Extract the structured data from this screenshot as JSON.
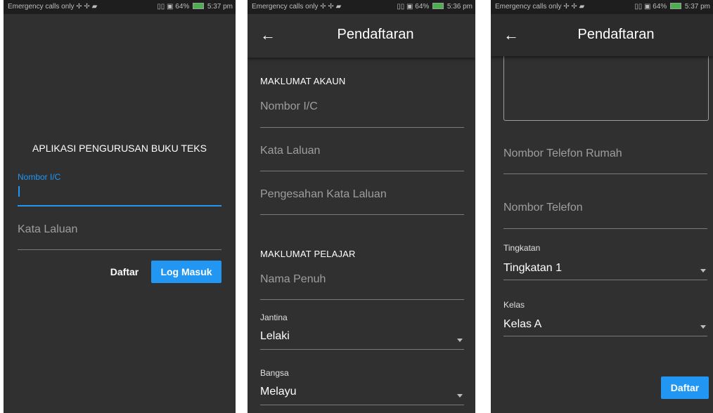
{
  "status": {
    "left": "Emergency calls only ✢ ✢ ▰",
    "right_p1": "▯▯ ▣ 64%",
    "time_p1": "5:37 pm",
    "right_p2": "▯▯ ▣ 64%",
    "time_p2": "5:36 pm",
    "right_p3": "▯▯ ▣ 64%",
    "time_p3": "5:37 pm"
  },
  "login": {
    "title": "APLIKASI PENGURUSAN BUKU TEKS",
    "ic_label": "Nombor I/C",
    "password_placeholder": "Kata Laluan",
    "register_button": "Daftar",
    "login_button": "Log Masuk",
    "accent_color": "#2196f3"
  },
  "register": {
    "title": "Pendaftaran",
    "back_icon": "arrow-left-icon",
    "account_section": "MAKLUMAT AKAUN",
    "ic_placeholder": "Nombor I/C",
    "password_placeholder": "Kata Laluan",
    "confirm_password_placeholder": "Pengesahan Kata Laluan",
    "student_section": "MAKLUMAT PELAJAR",
    "fullname_placeholder": "Nama Penuh",
    "gender_label": "Jantina",
    "gender_value": "Lelaki",
    "race_label": "Bangsa",
    "race_value": "Melayu"
  },
  "register2": {
    "title": "Pendaftaran",
    "home_phone_placeholder": "Nombor Telefon Rumah",
    "phone_placeholder": "Nombor Telefon",
    "form_label": "Tingkatan",
    "form_value": "Tingkatan 1",
    "class_label": "Kelas",
    "class_value": "Kelas A",
    "submit_button": "Daftar"
  }
}
